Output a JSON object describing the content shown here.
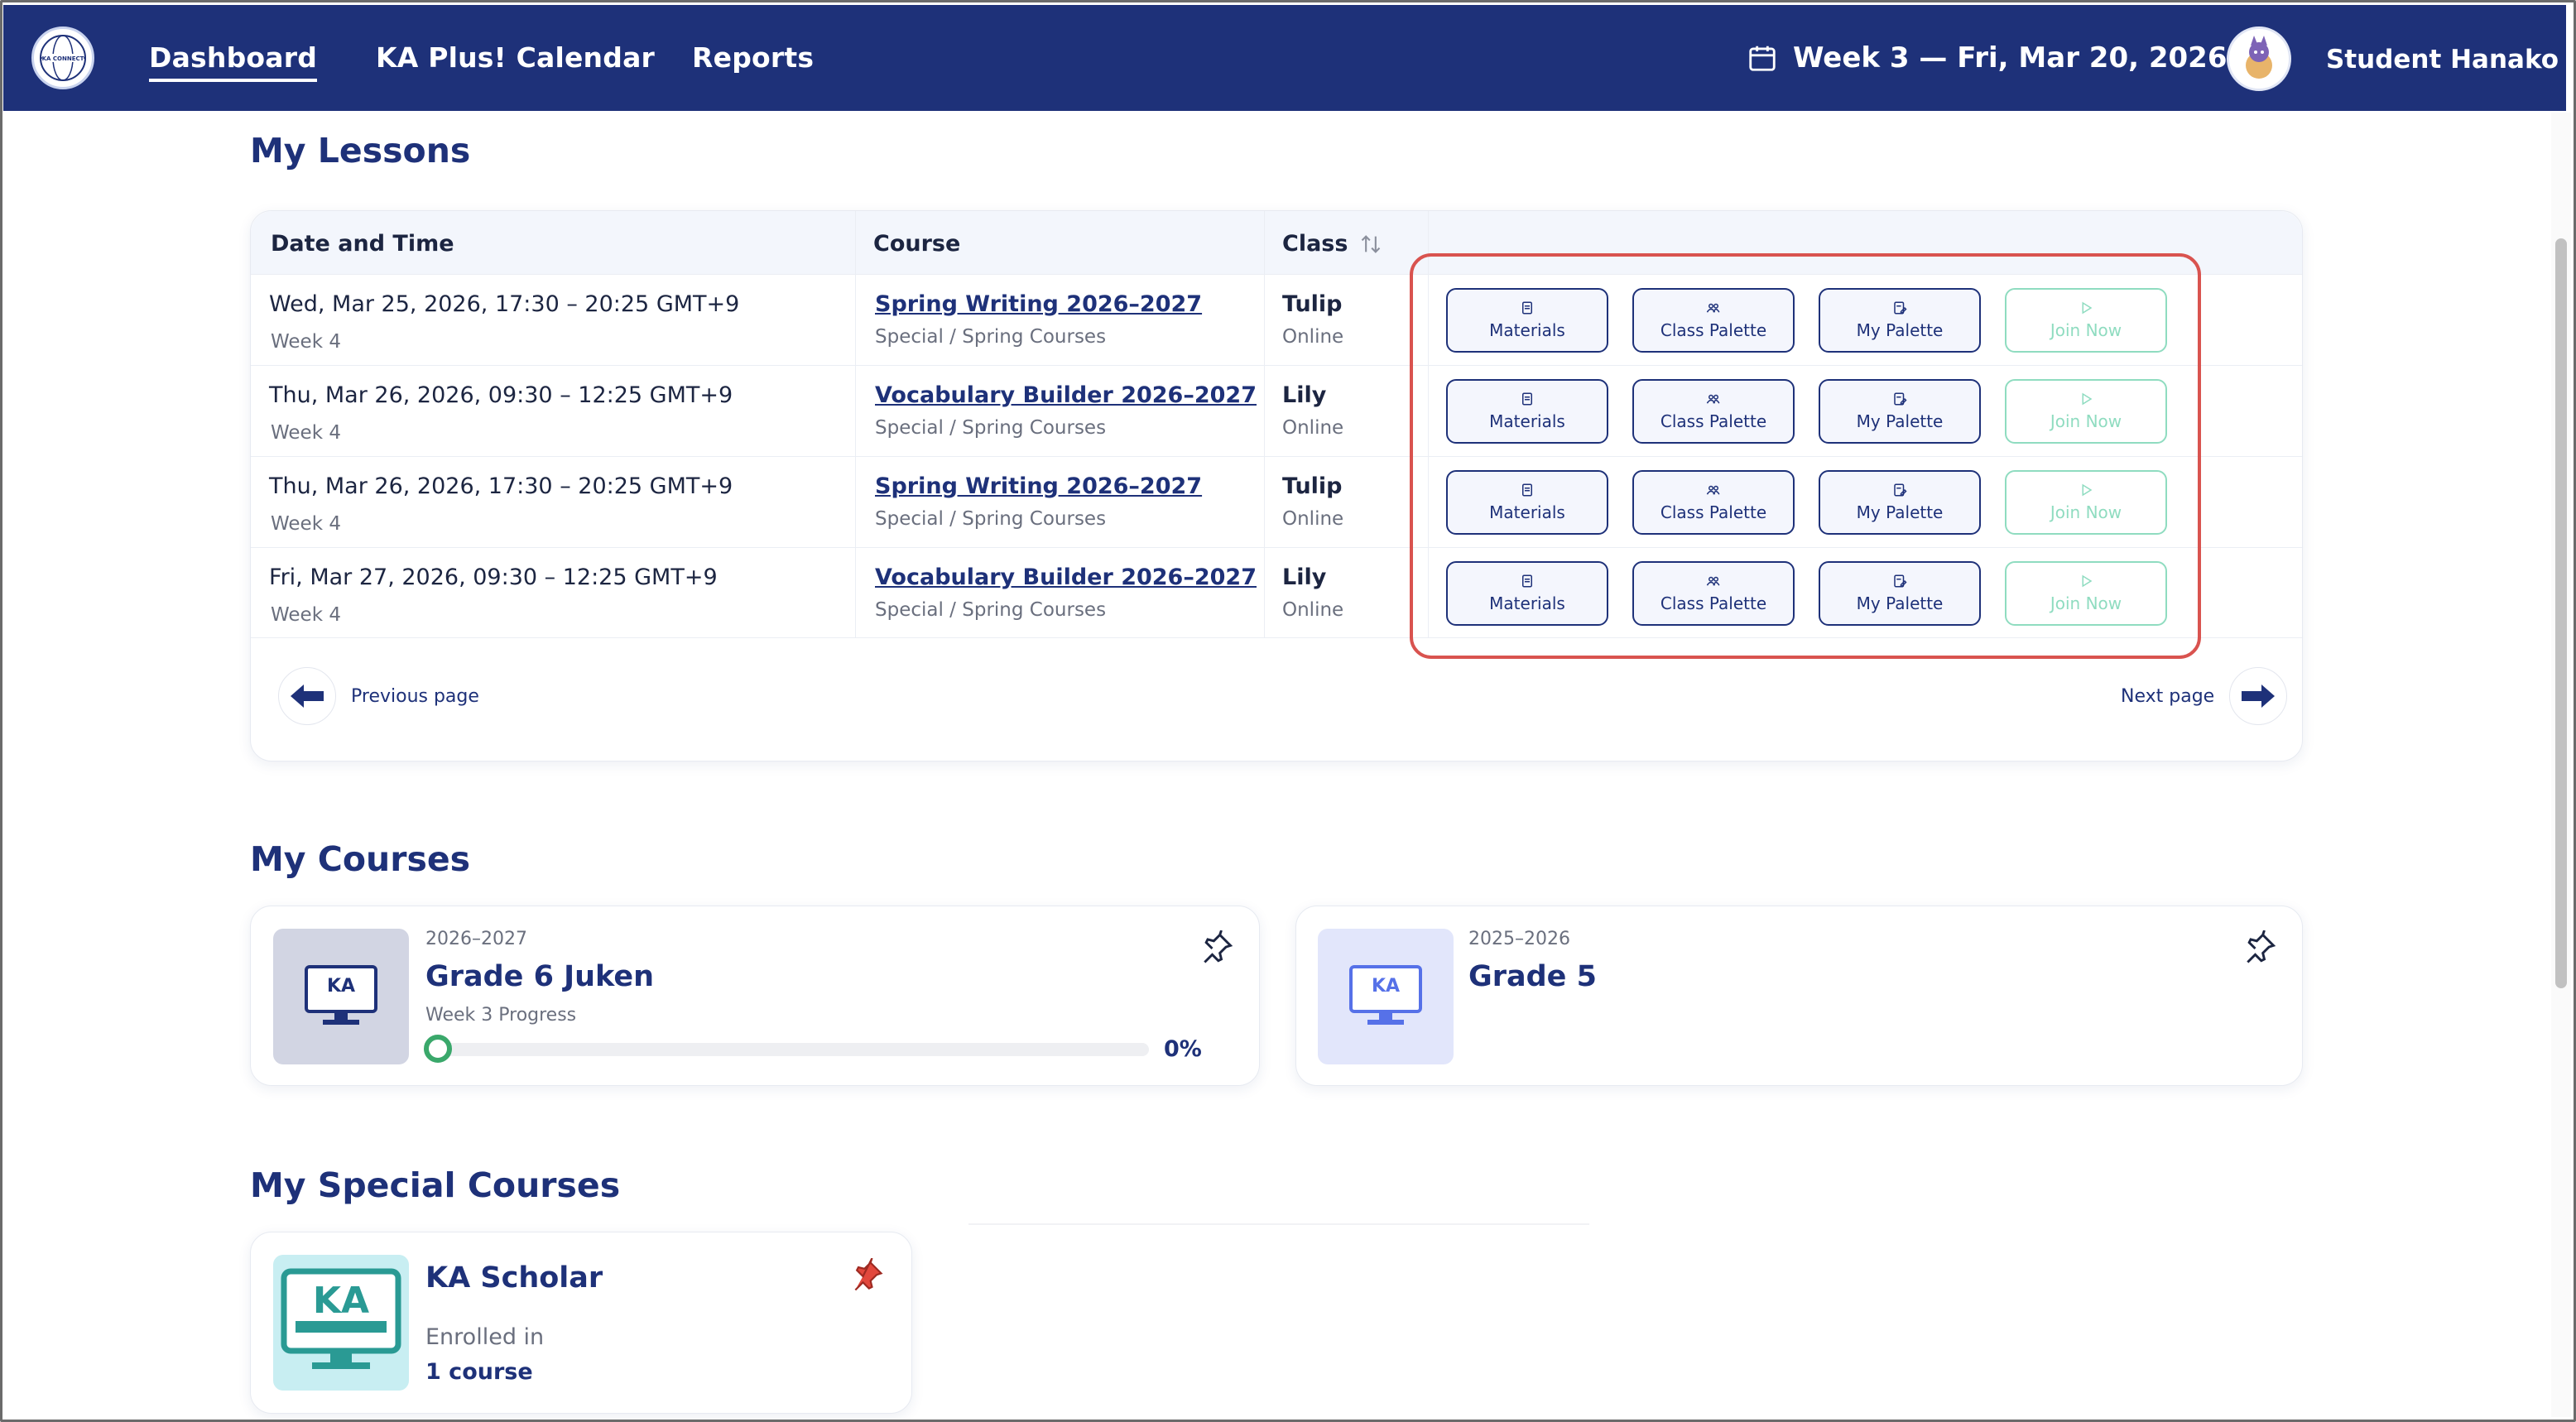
{
  "nav": {
    "logo_text": "KA CONNECT",
    "links": [
      "Dashboard",
      "KA Plus! Calendar",
      "Reports"
    ],
    "week_label": "Week 3 — Fri, Mar 20, 2026",
    "user_name": "Student Hanako"
  },
  "lessons": {
    "title": "My Lessons",
    "headers": {
      "date": "Date and Time",
      "course": "Course",
      "class": "Class"
    },
    "buttons": {
      "materials": "Materials",
      "class_palette": "Class Palette",
      "my_palette": "My Palette",
      "join": "Join Now"
    },
    "rows": [
      {
        "date": "Wed, Mar 25, 2026, 17:30 – 20:25 GMT+9",
        "week": "Week 4",
        "course": "Spring Writing 2026–2027",
        "category": "Special / Spring Courses",
        "class": "Tulip",
        "mode": "Online"
      },
      {
        "date": "Thu, Mar 26, 2026, 09:30 – 12:25 GMT+9",
        "week": "Week 4",
        "course": "Vocabulary Builder 2026–2027",
        "category": "Special / Spring Courses",
        "class": "Lily",
        "mode": "Online"
      },
      {
        "date": "Thu, Mar 26, 2026, 17:30 – 20:25 GMT+9",
        "week": "Week 4",
        "course": "Spring Writing 2026–2027",
        "category": "Special / Spring Courses",
        "class": "Tulip",
        "mode": "Online"
      },
      {
        "date": "Fri, Mar 27, 2026, 09:30 – 12:25 GMT+9",
        "week": "Week 4",
        "course": "Vocabulary Builder 2026–2027",
        "category": "Special / Spring Courses",
        "class": "Lily",
        "mode": "Online"
      }
    ],
    "prev_label": "Previous page",
    "next_label": "Next page"
  },
  "courses": {
    "title": "My Courses",
    "items": [
      {
        "year": "2026–2027",
        "name": "Grade 6 Juken",
        "progress_label": "Week 3 Progress",
        "progress_text": "0%",
        "progress": 0
      },
      {
        "year": "2025–2026",
        "name": "Grade 5"
      }
    ]
  },
  "special": {
    "title": "My Special Courses",
    "item": {
      "name": "KA Scholar",
      "enrolled_label": "Enrolled in",
      "count": "1 course"
    }
  },
  "colors": {
    "navy": "#1e3179",
    "join_disabled": "#8fdcc0",
    "highlight": "#d9534f",
    "pin_active": "#e2483d"
  }
}
